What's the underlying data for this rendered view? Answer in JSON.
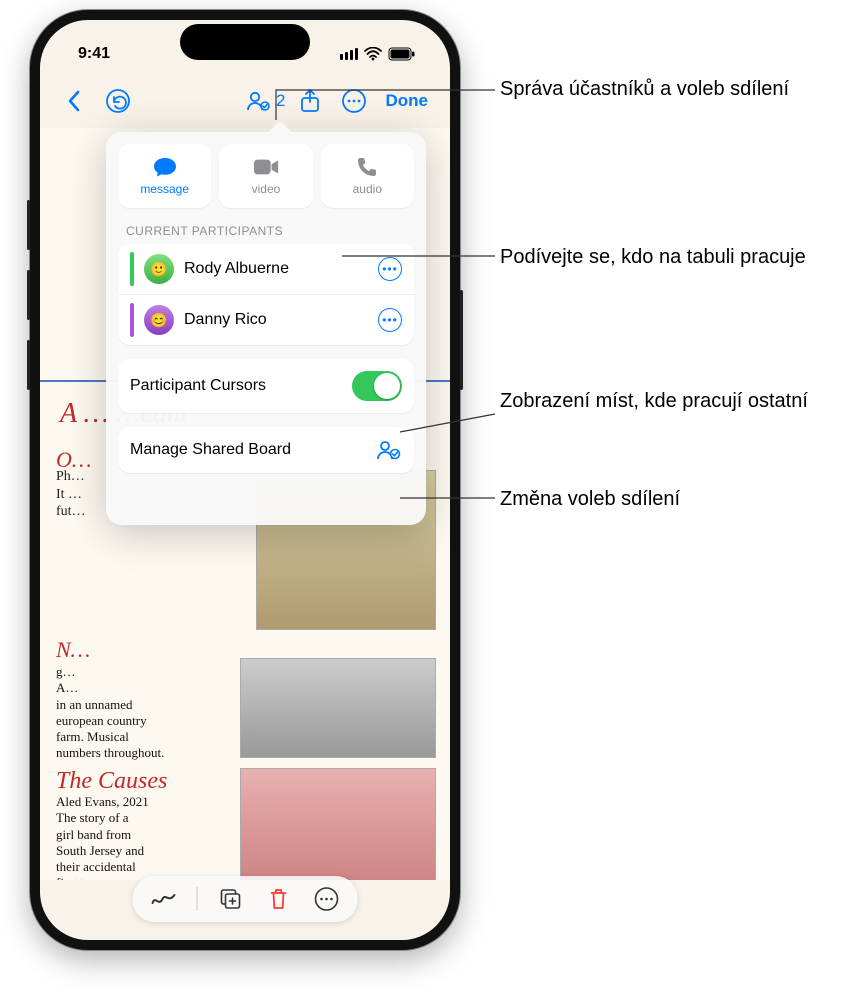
{
  "status": {
    "time": "9:41"
  },
  "toolbar": {
    "participants_count": "2",
    "done_label": "Done"
  },
  "popover": {
    "actions": {
      "message": "message",
      "video": "video",
      "audio": "audio"
    },
    "section_label": "CURRENT PARTICIPANTS",
    "participants": [
      {
        "name": "Rody Albuerne"
      },
      {
        "name": "Danny Rico"
      }
    ],
    "cursors_label": "Participant Cursors",
    "manage_label": "Manage Shared Board"
  },
  "board": {
    "title": "A …                        …eam",
    "sec1h": "O…",
    "sec1": "Ph…\nIt …\nfut…",
    "sec2h": "N…",
    "sec2": "g…\nA…\nin an unnamed\neuropean country\nfarm. Musical\nnumbers throughout.",
    "sec3h": "The Causes",
    "sec3": "Aled Evans, 2021\nThe story of a\ngirl band from\nSouth Jersey and\ntheir accidental\nfirst tour."
  },
  "callouts": {
    "c1": "Správa účastníků a voleb sdílení",
    "c2": "Podívejte se, kdo na tabuli pracuje",
    "c3": "Zobrazení míst, kde pracují ostatní",
    "c4": "Změna voleb sdílení"
  }
}
